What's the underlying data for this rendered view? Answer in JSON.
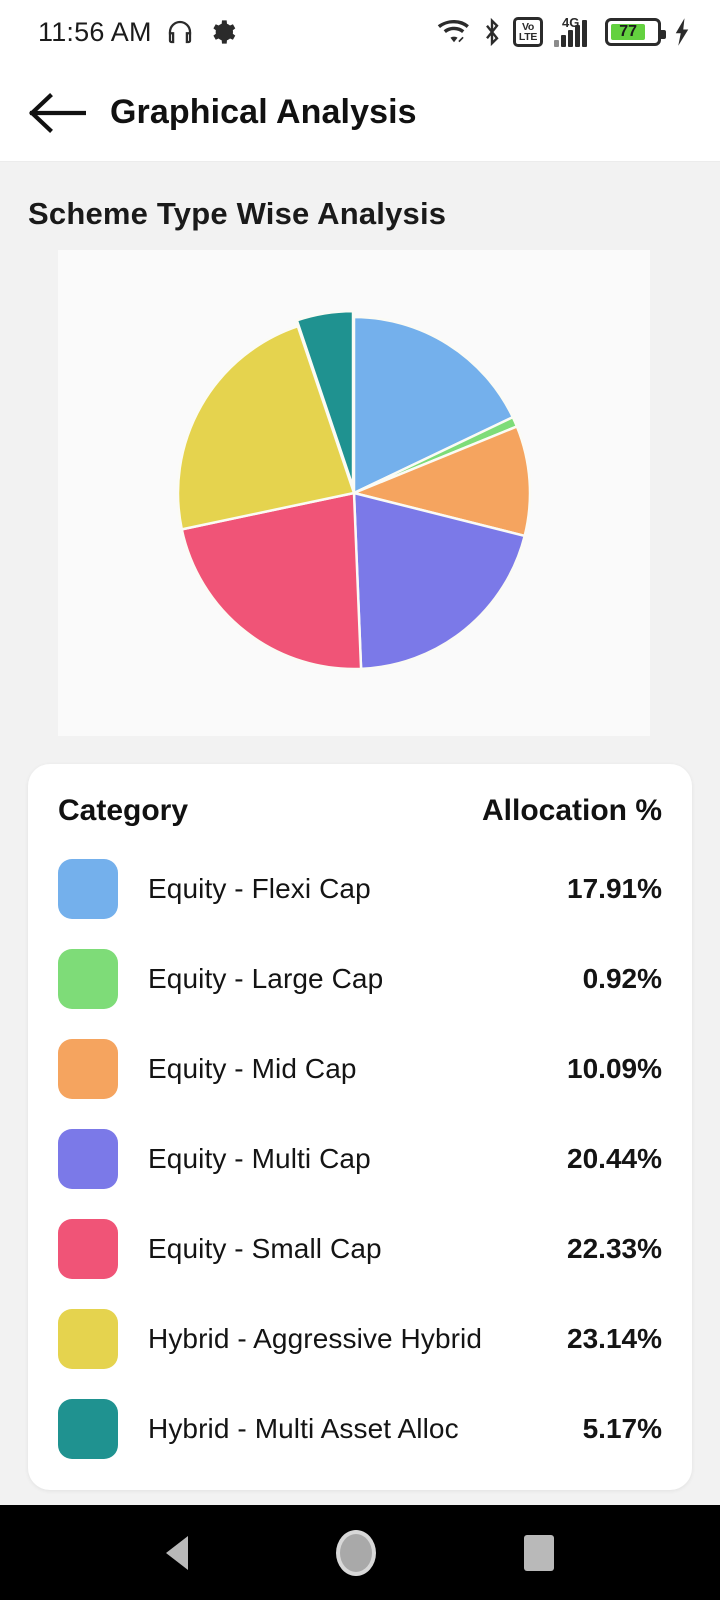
{
  "statusbar": {
    "time": "11:56 AM",
    "headphone_icon": "headphone-icon",
    "gear_icon": "gear-icon",
    "wifi_icon": "wifi-icon",
    "bluetooth_icon": "bluetooth-icon",
    "volte_top": "Vo",
    "volte_bottom": "LTE",
    "network_type": "4G",
    "battery_percent": "77",
    "charging_icon": "charging-bolt-icon"
  },
  "appbar": {
    "back_icon": "back-arrow-icon",
    "title": "Graphical Analysis"
  },
  "main": {
    "section_title": "Scheme Type Wise Analysis"
  },
  "table": {
    "header": {
      "category": "Category",
      "allocation": "Allocation %"
    },
    "rows": [
      {
        "label": "Equity - Flexi Cap",
        "value": "17.91%",
        "color": "#74b0ec"
      },
      {
        "label": "Equity - Large Cap",
        "value": "0.92%",
        "color": "#7edc78"
      },
      {
        "label": "Equity - Mid Cap",
        "value": "10.09%",
        "color": "#f5a45f"
      },
      {
        "label": "Equity - Multi Cap",
        "value": "20.44%",
        "color": "#7b79e8"
      },
      {
        "label": "Equity - Small Cap",
        "value": "22.33%",
        "color": "#f05477"
      },
      {
        "label": "Hybrid - Aggressive Hybrid",
        "value": "23.14%",
        "color": "#e5d34e"
      },
      {
        "label": "Hybrid - Multi Asset Alloc",
        "value": "5.17%",
        "color": "#1f9290"
      }
    ]
  },
  "navbar": {
    "back_icon": "nav-back-triangle-icon",
    "home_icon": "nav-home-circle-icon",
    "recent_icon": "nav-recent-square-icon"
  },
  "chart_data": {
    "type": "pie",
    "title": "Scheme Type Wise Analysis",
    "labels": [
      "Equity - Flexi Cap",
      "Equity - Large Cap",
      "Equity - Mid Cap",
      "Equity - Multi Cap",
      "Equity - Small Cap",
      "Hybrid - Aggressive Hybrid",
      "Hybrid - Multi Asset Alloc"
    ],
    "values": [
      17.91,
      0.92,
      10.09,
      20.44,
      22.33,
      23.14,
      5.17
    ],
    "unit": "%",
    "colors": [
      "#74b0ec",
      "#7edc78",
      "#f5a45f",
      "#7b79e8",
      "#f05477",
      "#e5d34e",
      "#1f9290"
    ],
    "start_angle_deg": -90,
    "direction": "clockwise",
    "legend": "table-below",
    "grid": false
  }
}
